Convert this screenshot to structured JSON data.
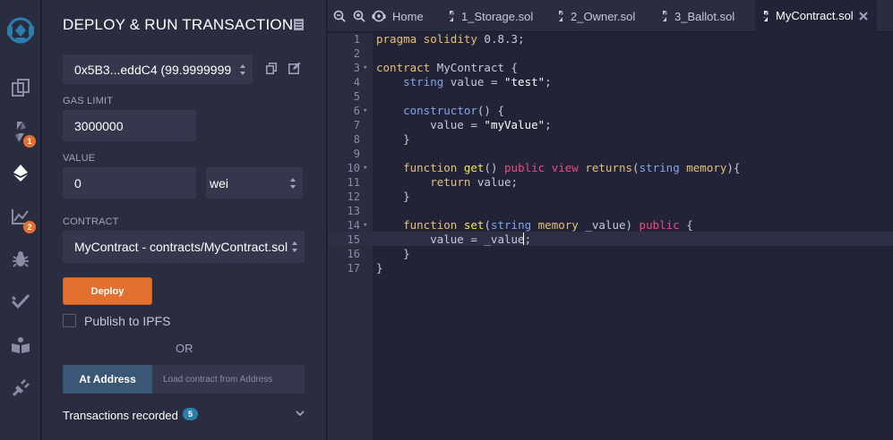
{
  "rail": {
    "items": [
      {
        "name": "logo",
        "icon": "remix-logo-icon"
      },
      {
        "name": "file-explorer",
        "icon": "files-icon"
      },
      {
        "name": "solidity-compiler",
        "icon": "compiler-icon",
        "badge": "1"
      },
      {
        "name": "deploy-run",
        "icon": "ethereum-icon"
      },
      {
        "name": "analysis",
        "icon": "chart-icon",
        "badge": "2"
      },
      {
        "name": "debugger",
        "icon": "bug-icon"
      },
      {
        "name": "testing",
        "icon": "check-icon"
      },
      {
        "name": "learn",
        "icon": "book-icon"
      },
      {
        "name": "plugin-manager",
        "icon": "plug-icon"
      }
    ]
  },
  "panel": {
    "title": "DEPLOY & RUN TRANSACTIONS",
    "account": {
      "value": "0x5B3...eddC4 (99.9999999"
    },
    "gas_limit": {
      "label": "GAS LIMIT",
      "value": "3000000"
    },
    "value": {
      "label": "VALUE",
      "value": "0",
      "unit": "wei"
    },
    "contract": {
      "label": "CONTRACT",
      "value": "MyContract - contracts/MyContract.sol"
    },
    "deploy_label": "Deploy",
    "publish_label": "Publish to IPFS",
    "or_label": "OR",
    "at_address_label": "At Address",
    "address_placeholder": "Load contract from Address",
    "transactions_label": "Transactions recorded",
    "transactions_count": "5"
  },
  "tabs": {
    "home": "Home",
    "files": [
      "1_Storage.sol",
      "2_Owner.sol",
      "3_Ballot.sol",
      "MyContract.sol"
    ],
    "active": "MyContract.sol"
  },
  "editor": {
    "line_numbers": [
      "1",
      "2",
      "3",
      "4",
      "5",
      "6",
      "7",
      "8",
      "9",
      "10",
      "11",
      "12",
      "13",
      "14",
      "15",
      "16",
      "17"
    ],
    "current_line": 15,
    "code": [
      "pragma solidity 0.8.3;",
      "",
      "contract MyContract {",
      "    string value = \"test\";",
      "",
      "    constructor() {",
      "        value = \"myValue\";",
      "    }",
      "",
      "    function get() public view returns(string memory){",
      "        return value;",
      "    }",
      "",
      "    function set(string memory _value) public {",
      "        value = _value;",
      "    }",
      "}"
    ]
  },
  "colors": {
    "accent_orange": "#e2702f",
    "at_address_blue": "#3b5776",
    "badge_blue": "#2c7fad",
    "keyword_yellow": "#e5c07b",
    "keyword_blue": "#7fa7e6",
    "keyword_pink": "#e94b87"
  }
}
